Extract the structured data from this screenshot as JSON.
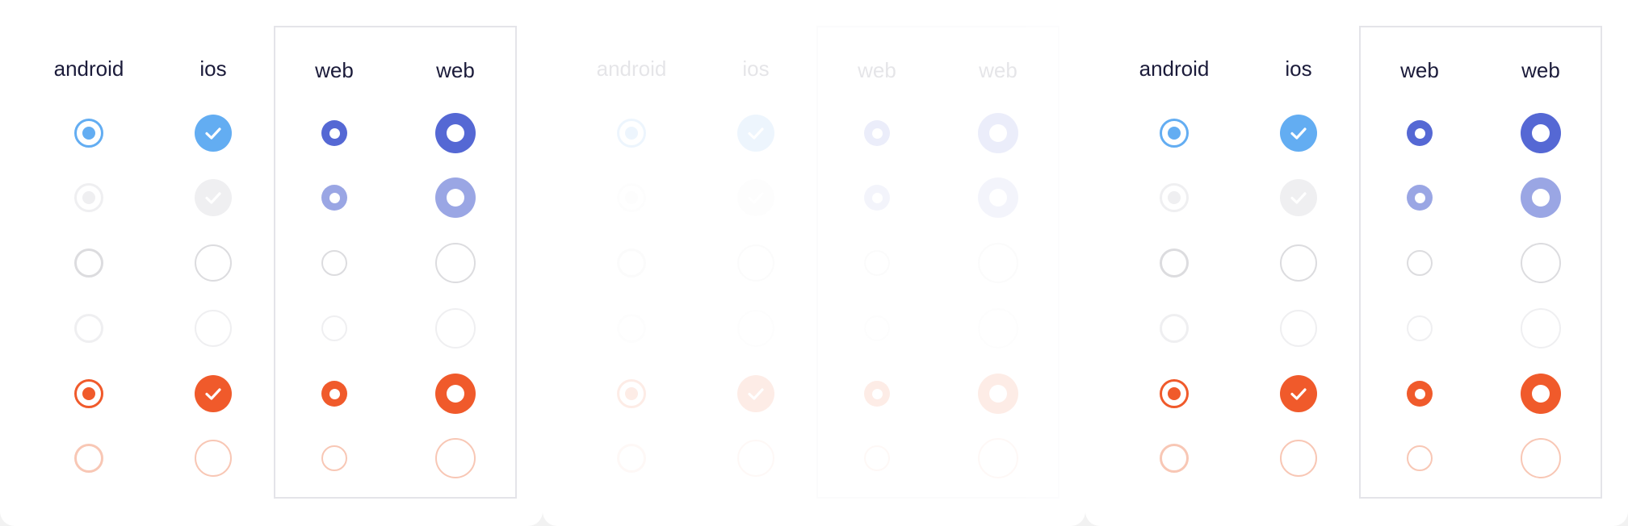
{
  "colors": {
    "blue_light": "#63adf2",
    "indigo": "#5568d4",
    "indigo_light": "#9aa6e4",
    "orange": "#f05a2b",
    "orange_light": "#f8c7b5",
    "grey_border": "#dcdcdf",
    "grey_disabled": "#efeff1",
    "header_text": "#1b1b3a"
  },
  "panels": [
    {
      "state": "normal",
      "headers": [
        "android",
        "ios",
        "web",
        "web"
      ]
    },
    {
      "state": "faded",
      "headers": [
        "android",
        "ios",
        "web",
        "web"
      ]
    },
    {
      "state": "normal",
      "headers": [
        "android",
        "ios",
        "web",
        "web"
      ]
    }
  ],
  "rows": [
    "selected-blue",
    "selected-disabled",
    "unselected",
    "unselected-disabled",
    "selected-error",
    "unselected-error"
  ]
}
